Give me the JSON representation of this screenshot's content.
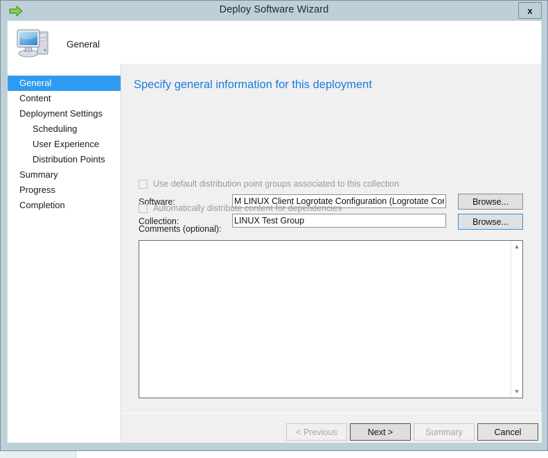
{
  "window": {
    "title": "Deploy Software Wizard",
    "title_icon": "green-right-arrow-icon",
    "close_label": "x"
  },
  "banner": {
    "title": "General",
    "icon": "computer-icon"
  },
  "sidebar": {
    "items": [
      {
        "label": "General",
        "level": 0,
        "selected": true
      },
      {
        "label": "Content",
        "level": 0,
        "selected": false
      },
      {
        "label": "Deployment Settings",
        "level": 0,
        "selected": false
      },
      {
        "label": "Scheduling",
        "level": 1,
        "selected": false
      },
      {
        "label": "User Experience",
        "level": 1,
        "selected": false
      },
      {
        "label": "Distribution Points",
        "level": 1,
        "selected": false
      },
      {
        "label": "Summary",
        "level": 0,
        "selected": false
      },
      {
        "label": "Progress",
        "level": 0,
        "selected": false
      },
      {
        "label": "Completion",
        "level": 0,
        "selected": false
      }
    ]
  },
  "main": {
    "heading": "Specify general information for this deployment",
    "software": {
      "label": "Software:",
      "value": "M LINUX Client Logrotate Configuration (Logrotate Config Setup)",
      "browse_label": "Browse..."
    },
    "collection": {
      "label": "Collection:",
      "value": "LINUX Test Group",
      "browse_label": "Browse..."
    },
    "checkbox_default_dp_groups": {
      "label": "Use default distribution point groups associated to this collection",
      "checked": false,
      "disabled": true
    },
    "checkbox_auto_distribute": {
      "label": "Automatically distribute content for dependencies",
      "checked": false,
      "disabled": true
    },
    "comments": {
      "label": "Comments (optional):",
      "value": "",
      "scroll_up_icon": "chevron-up-icon",
      "scroll_down_icon": "chevron-down-icon"
    }
  },
  "footer": {
    "previous_label": "< Previous",
    "next_label": "Next >",
    "summary_label": "Summary",
    "cancel_label": "Cancel"
  },
  "colors": {
    "frame": "#bdd0da",
    "accent_heading": "#1a7ae0",
    "selection": "#2e9bf0",
    "panel": "#f0f0f0",
    "disabled_text": "#999999"
  }
}
